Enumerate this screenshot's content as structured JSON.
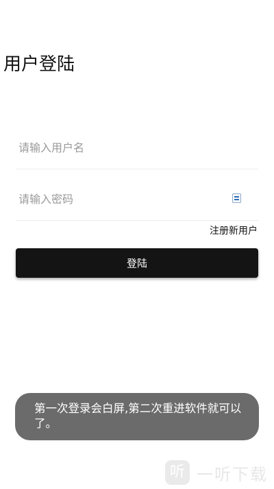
{
  "header": {
    "title": "用户登陆"
  },
  "form": {
    "username_placeholder": "请输入用户名",
    "username_value": "",
    "password_placeholder": "请输入密码",
    "password_value": "",
    "password_toggle_icon": "keyboard-icon",
    "register_link": "注册新用户",
    "login_button": "登陆"
  },
  "toast": {
    "message": "第一次登录会白屏,第二次重进软件就可以了。"
  },
  "watermark": {
    "logo_glyph": "听",
    "text": "一听下载"
  },
  "colors": {
    "button_background": "#141414",
    "toast_background": "#6b6b6b",
    "divider": "#ececec",
    "placeholder": "#9a9a9a"
  }
}
